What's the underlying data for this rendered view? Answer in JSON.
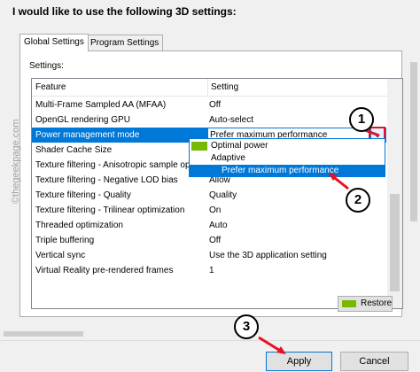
{
  "heading": "I would like to use the following 3D settings:",
  "tabs": [
    {
      "label": "Global Settings",
      "active": true
    },
    {
      "label": "Program Settings",
      "active": false
    }
  ],
  "settings_label": "Settings:",
  "columns": {
    "feature": "Feature",
    "setting": "Setting"
  },
  "rows": [
    {
      "feature": "Multi-Frame Sampled AA (MFAA)",
      "setting": "Off"
    },
    {
      "feature": "OpenGL rendering GPU",
      "setting": "Auto-select"
    },
    {
      "feature": "Power management mode",
      "setting": "Prefer maximum performance",
      "selected": true
    },
    {
      "feature": "Shader Cache Size",
      "setting": ""
    },
    {
      "feature": "Texture filtering - Anisotropic sample opti...",
      "setting": ""
    },
    {
      "feature": "Texture filtering - Negative LOD bias",
      "setting": "Allow"
    },
    {
      "feature": "Texture filtering - Quality",
      "setting": "Quality"
    },
    {
      "feature": "Texture filtering - Trilinear optimization",
      "setting": "On"
    },
    {
      "feature": "Threaded optimization",
      "setting": "Auto"
    },
    {
      "feature": "Triple buffering",
      "setting": "Off"
    },
    {
      "feature": "Vertical sync",
      "setting": "Use the 3D application setting"
    },
    {
      "feature": "Virtual Reality pre-rendered frames",
      "setting": "1"
    }
  ],
  "combo": {
    "value": "Prefer maximum performance"
  },
  "dropdown_options": [
    {
      "label": "Optimal power",
      "icon": "nvidia-icon"
    },
    {
      "label": "Adaptive"
    },
    {
      "label": "Prefer maximum performance",
      "highlighted": true
    }
  ],
  "restore_label": "Restore",
  "buttons": {
    "apply": "Apply",
    "cancel": "Cancel"
  },
  "watermark": "©thegeekpage.com",
  "callouts": [
    "1",
    "2",
    "3"
  ],
  "colors": {
    "selection": "#0078d7",
    "nvidia_green": "#76b900",
    "highlight_red": "#e81123"
  }
}
